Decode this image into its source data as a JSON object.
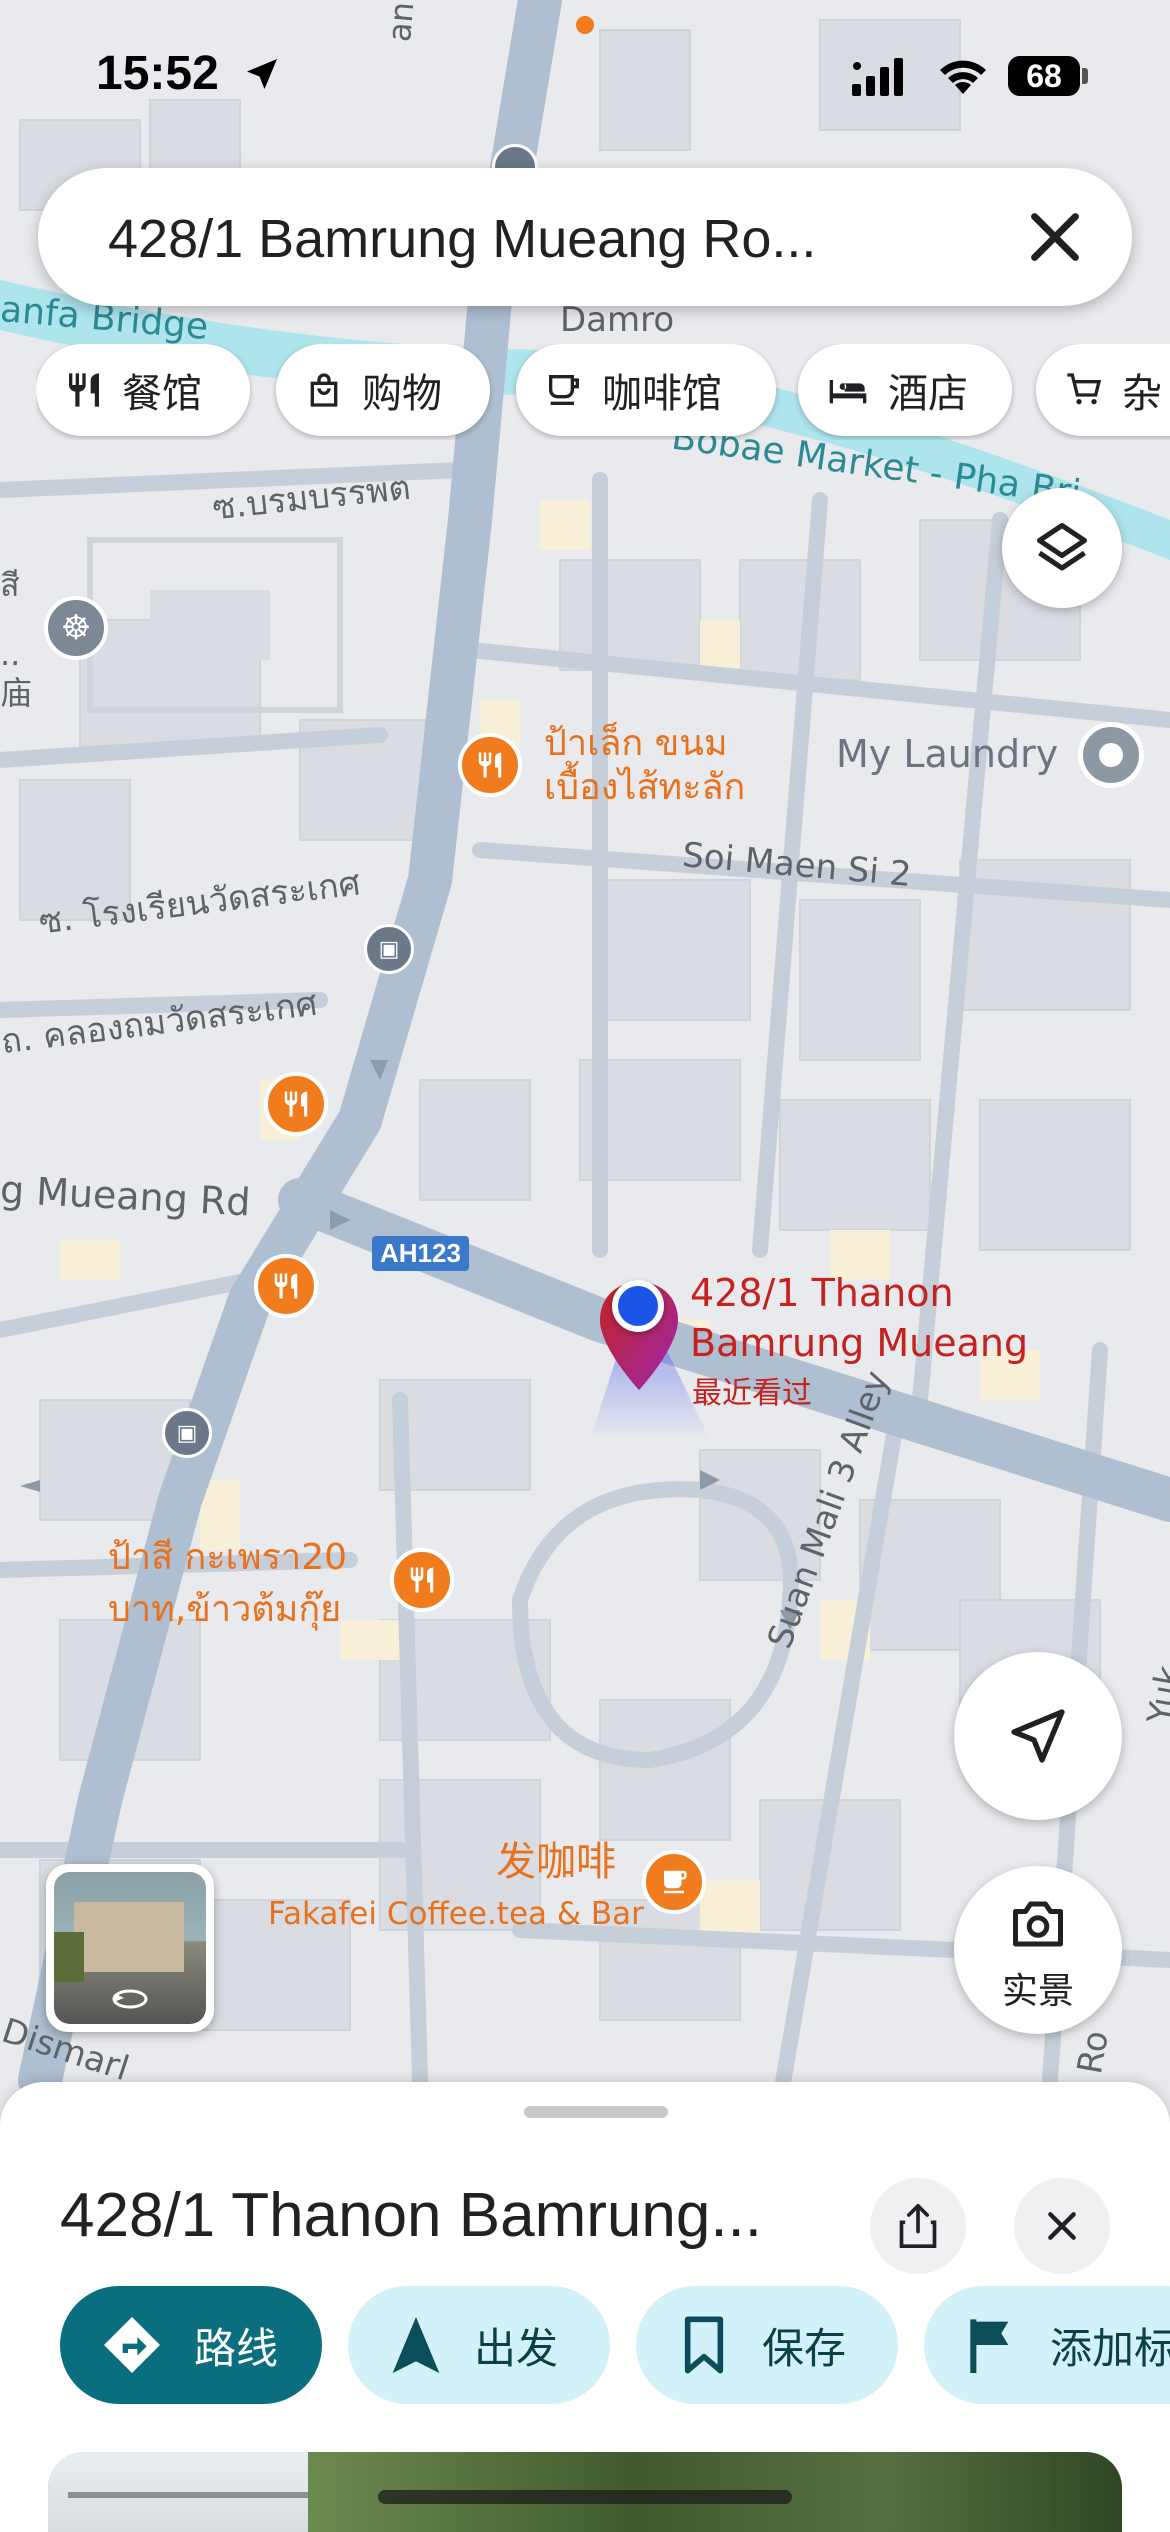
{
  "status_bar": {
    "time": "15:52",
    "battery": "68"
  },
  "search": {
    "value": "428/1 Bamrung Mueang Ro..."
  },
  "chips": [
    {
      "label": "餐馆",
      "icon": "restaurant-icon"
    },
    {
      "label": "购物",
      "icon": "shopping-bag-icon"
    },
    {
      "label": "咖啡馆",
      "icon": "coffee-icon"
    },
    {
      "label": "酒店",
      "icon": "hotel-bed-icon"
    },
    {
      "label": "杂",
      "icon": "cart-icon"
    }
  ],
  "map": {
    "streets": {
      "damrong": "Damro",
      "anfa_bridge": "anfa Bridge",
      "bobae": "Bobae Market - Pha Bri",
      "soi_borommabophit": "ซ.บรมบรรพต",
      "soi_maen_si": "Soi Maen Si 2",
      "soi_school": "ซ. โรงเรียนวัดสระเกศ",
      "khlong_thom": "ถ. คลองถมวัดสระเกศ",
      "mueang_rd": "g Mueang Rd",
      "suan_mali": "Suan Mali 3 Alley",
      "luang": "an Luang",
      "dismark": "Dismarl",
      "yuk": "Yuk",
      "ro": "Ro"
    },
    "highway_badge": "AH123",
    "pois": {
      "pa_lek_line1": "ป้าเล็ก ขนม",
      "pa_lek_line2": "เบื้องไส้ทะลัก",
      "my_laundry": "My Laundry",
      "pa_si_line1": "ป้าสี กะเพรา20",
      "pa_si_line2": "บาท,ข้าวต้มกุ๊ย",
      "cafe_cn": "发咖啡",
      "cafe_en": "Fakafei Coffee.tea & Bar",
      "left_edge_1": "สี",
      "left_edge_2": "..",
      "left_edge_3": "庙"
    },
    "pin": {
      "line1": "428/1 Thanon",
      "line2": "Bamrung Mueang",
      "recent": "最近看过"
    },
    "live_view_label": "实景"
  },
  "sheet": {
    "title": "428/1 Thanon Bamrung...",
    "actions": [
      {
        "label": "路线",
        "icon": "directions-icon",
        "primary": true
      },
      {
        "label": "出发",
        "icon": "navigation-arrow-icon",
        "primary": false
      },
      {
        "label": "保存",
        "icon": "bookmark-icon",
        "primary": false
      },
      {
        "label": "添加标",
        "icon": "flag-icon",
        "primary": false
      }
    ]
  },
  "colors": {
    "primary_teal": "#0b6e7e",
    "light_teal": "#d3f1f9",
    "poi_orange": "#f07c1d",
    "pin_red": "#c5221f",
    "road": "#aebfd1",
    "water": "#aee4ec"
  }
}
